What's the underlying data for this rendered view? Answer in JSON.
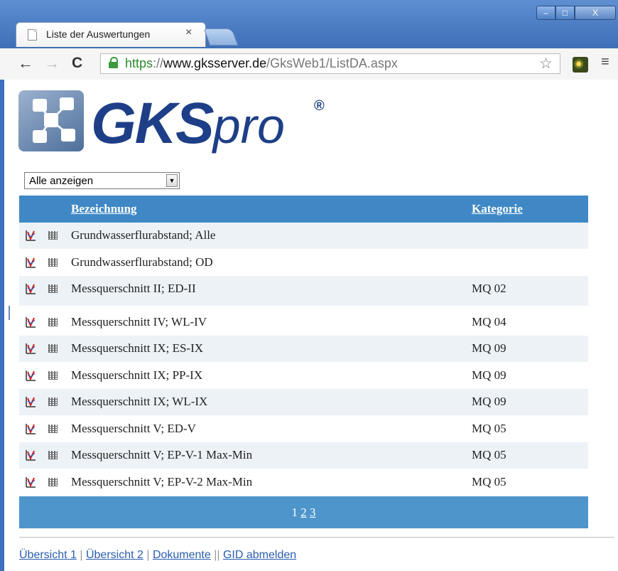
{
  "browser": {
    "tab_title": "Liste der Auswertungen",
    "tab_close": "×",
    "url_scheme": "https",
    "url_sep": "://",
    "url_host": "www.gksserver.de",
    "url_path": "/GksWeb1/ListDA.aspx",
    "window_buttons": {
      "minimize": "–",
      "maximize": "□",
      "close": "X"
    }
  },
  "logo": {
    "brand": "GKS",
    "suffix": "pro",
    "reg": "®"
  },
  "filter": {
    "selected": "Alle anzeigen"
  },
  "table": {
    "headers": {
      "name": "Bezeichnung",
      "category": "Kategorie"
    },
    "rows": [
      {
        "name": "Grundwasserflurabstand; Alle",
        "category": ""
      },
      {
        "name": "Grundwasserflurabstand; OD",
        "category": ""
      },
      {
        "name": "Messquerschnitt II; ED-II",
        "category": "MQ 02"
      },
      {
        "name": "Messquerschnitt IV; WL-IV",
        "category": "MQ 04"
      },
      {
        "name": "Messquerschnitt IX; ES-IX",
        "category": "MQ 09"
      },
      {
        "name": "Messquerschnitt IX; PP-IX",
        "category": "MQ 09"
      },
      {
        "name": "Messquerschnitt IX; WL-IX",
        "category": "MQ 09"
      },
      {
        "name": "Messquerschnitt V; ED-V",
        "category": "MQ 05"
      },
      {
        "name": "Messquerschnitt V; EP-V-1 Max-Min",
        "category": "MQ 05"
      },
      {
        "name": "Messquerschnitt V; EP-V-2 Max-Min",
        "category": "MQ 05"
      }
    ]
  },
  "pager": {
    "current": "1",
    "page2": "2",
    "page3": "3"
  },
  "footer": {
    "link1": "Übersicht 1",
    "sep1": " | ",
    "link2": "Übersicht 2",
    "sep2": " | ",
    "link3": "Dokumente",
    "sep3": " || ",
    "link4": "GID abmelden"
  },
  "colors": {
    "header": "#3f88c5",
    "pager": "#4e95cc",
    "alt_row": "#edf2f7",
    "brand": "#1e3f87"
  }
}
